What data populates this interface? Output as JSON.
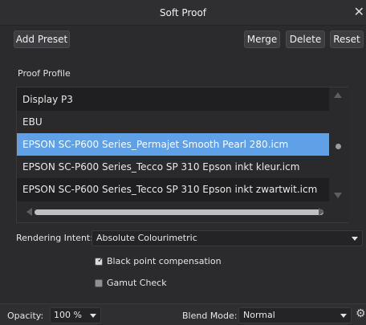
{
  "window": {
    "title": "Soft Proof",
    "close_glyph": "✕"
  },
  "toolbar": {
    "add_preset_label": "Add Preset",
    "merge_label": "Merge",
    "delete_label": "Delete",
    "reset_label": "Reset"
  },
  "proof_profile": {
    "section_label": "Proof Profile",
    "items": [
      {
        "label": "Display P3"
      },
      {
        "label": "EBU"
      },
      {
        "label": "EPSON SC-P600 Series_Permajet Smooth Pearl 280.icm",
        "selected": true
      },
      {
        "label": "EPSON SC-P600 Series_Tecco SP 310 Epson inkt kleur.icm"
      },
      {
        "label": "EPSON SC-P600 Series_Tecco SP 310 Epson inkt zwartwit.icm"
      }
    ]
  },
  "rendering_intent": {
    "label": "Rendering Intent:",
    "value": "Absolute Colourimetric"
  },
  "options": {
    "black_point": {
      "label": "Black point compensation",
      "checked": true
    },
    "gamut_check": {
      "label": "Gamut Check",
      "checked": false
    }
  },
  "bottom": {
    "opacity_label": "Opacity:",
    "opacity_value": "100 %",
    "blend_mode_label": "Blend Mode:",
    "blend_mode_value": "Normal"
  },
  "colors": {
    "selection": "#5fa0e6",
    "panel": "#2b2b2e",
    "list_bg": "#1f1f21"
  },
  "icons": {
    "close": "close-icon",
    "settings": "gear-icon",
    "check": "checkmark-icon"
  }
}
